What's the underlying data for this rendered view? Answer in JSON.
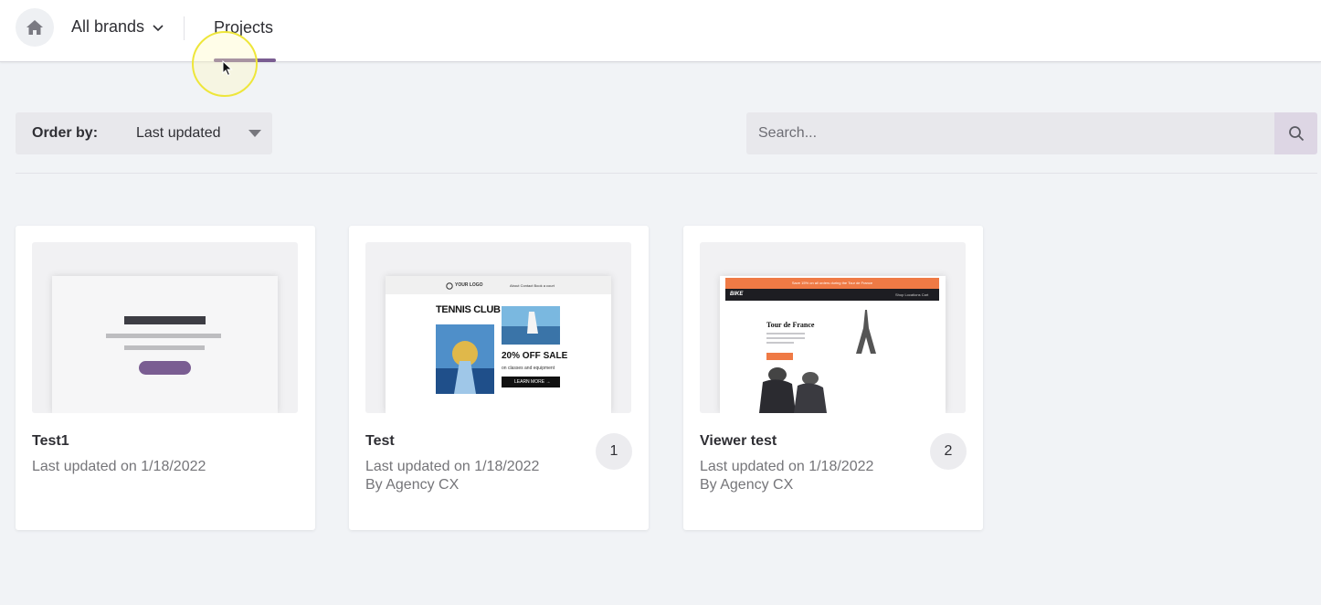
{
  "topbar": {
    "brand_selector": "All brands",
    "tab_projects": "Projects"
  },
  "toolbar": {
    "order_by_label": "Order by:",
    "order_by_value": "Last updated",
    "search_placeholder": "Search..."
  },
  "colors": {
    "accent": "#7a5d92",
    "background": "#f1f3f6",
    "card": "#ffffff"
  },
  "projects": [
    {
      "title": "Test1",
      "updated": "Last updated on 1/18/2022",
      "author": "",
      "badge": ""
    },
    {
      "title": "Test",
      "updated": "Last updated on 1/18/2022",
      "author": "By Agency CX",
      "badge": "1",
      "thumb": {
        "logo": "YOUR LOGO",
        "nav": "About   Contact   Book a court",
        "headline": "TENNIS CLUB",
        "offer": "20% OFF SALE",
        "sub": "on classes and equipment",
        "cta": "LEARN MORE →"
      }
    },
    {
      "title": "Viewer test",
      "updated": "Last updated on 1/18/2022",
      "author": "By Agency CX",
      "badge": "2",
      "thumb": {
        "banner": "Save 15% on all orders during the Tour de France",
        "logo": "BIKE",
        "nav": "Shop   Locations   Cart",
        "headline": "Tour de France"
      }
    }
  ]
}
